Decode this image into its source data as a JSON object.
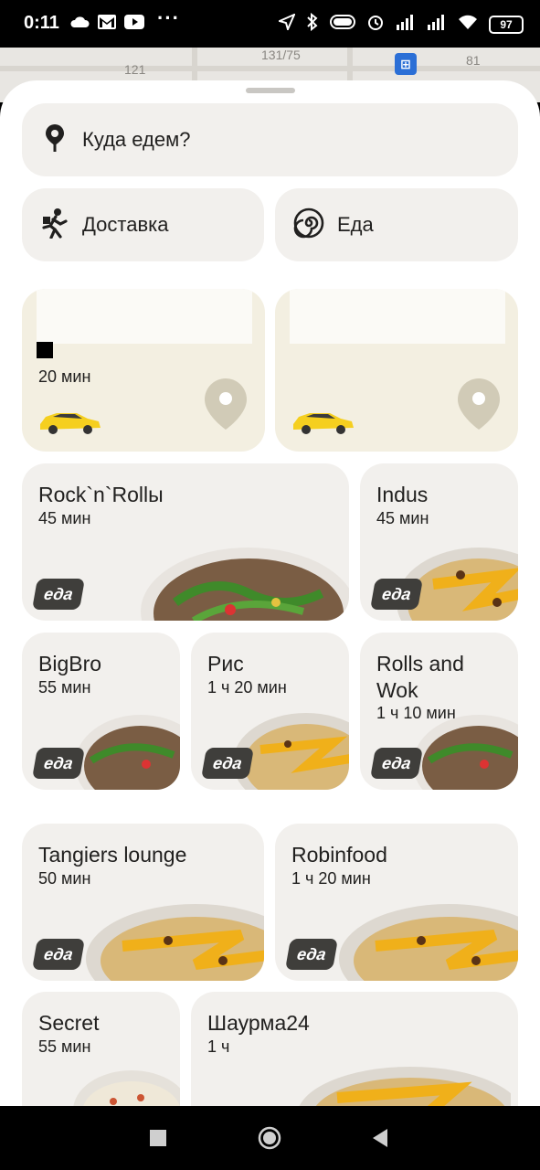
{
  "status_bar": {
    "time": "0:11",
    "battery": "97",
    "icons": [
      "cloud-icon",
      "gmail-icon",
      "youtube-icon",
      "more-dots-icon",
      "location-icon",
      "bluetooth-icon",
      "toggle-icon",
      "alarm-icon",
      "signal-icon",
      "signal-icon",
      "wifi-icon",
      "battery-icon"
    ]
  },
  "map": {
    "labels": [
      "121",
      "131/75",
      "81"
    ]
  },
  "search": {
    "placeholder": "Куда едем?",
    "icon": "pin-icon"
  },
  "quick_actions": [
    {
      "label": "Доставка",
      "icon": "walking-courier-icon"
    },
    {
      "label": "Еда",
      "icon": "spiral-icon"
    }
  ],
  "taxi_cards": [
    {
      "time": "20 мин",
      "icon": "taxi-car-icon"
    },
    {
      "time": "",
      "icon": "taxi-car-icon"
    }
  ],
  "restaurants": [
    {
      "name": "Rock`n`Rollы",
      "time": "45 мин",
      "badge": "еда"
    },
    {
      "name": "Indus",
      "time": "45 мин",
      "badge": "еда"
    },
    {
      "name": "BigBro",
      "time": "55 мин",
      "badge": "еда"
    },
    {
      "name": "Рис",
      "time": "1 ч 20 мин",
      "badge": "еда"
    },
    {
      "name": "Rolls and Wok",
      "time": "1 ч 10 мин",
      "badge": "еда"
    },
    {
      "name": "Tangiers lounge",
      "time": "50 мин",
      "badge": "еда"
    },
    {
      "name": "Robinfood",
      "time": "1 ч 20 мин",
      "badge": "еда"
    },
    {
      "name": "Secret",
      "time": "55 мин",
      "badge": ""
    },
    {
      "name": "Шаурма24",
      "time": "1 ч",
      "badge": ""
    }
  ],
  "colors": {
    "card_bg": "#f2f0ed",
    "taxi_card_bg": "#f3efe1",
    "badge_bg": "#3f3e3b",
    "taxi_yellow": "#f5cf1f"
  }
}
